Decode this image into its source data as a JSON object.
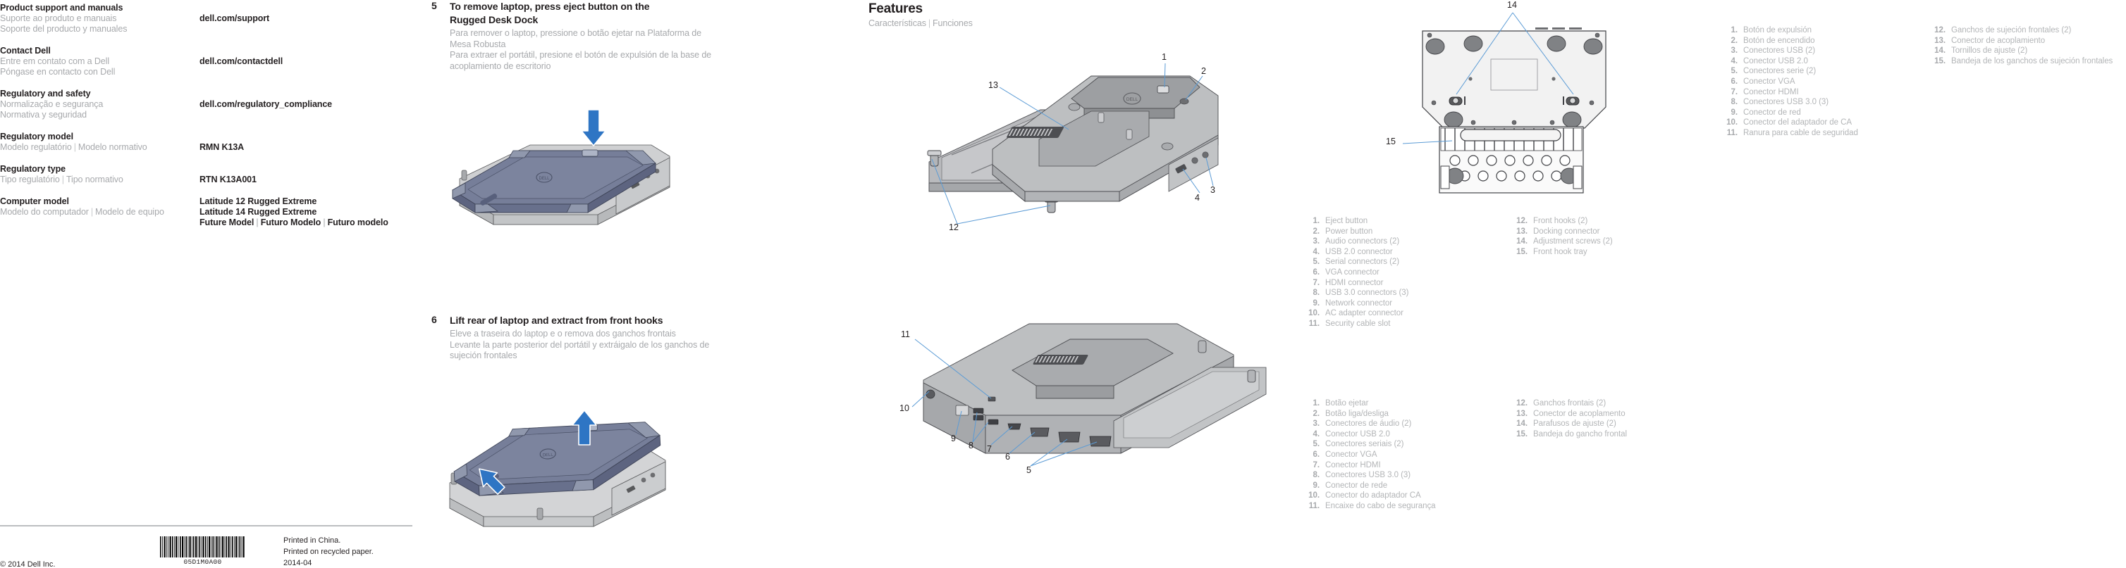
{
  "support": {
    "rows": [
      {
        "heading": "Product support and manuals",
        "pt": "Suporte ao produto e manuais",
        "es": "Soporte del producto y manuales",
        "value": "dell.com/support"
      },
      {
        "heading": "Contact Dell",
        "pt": "Entre em contato com a Dell",
        "es": "Póngase en contacto con Dell",
        "value": "dell.com/contactdell"
      },
      {
        "heading": "Regulatory and safety",
        "pt": "Normalização e segurança",
        "es": "Normativa y seguridad",
        "value": "dell.com/regulatory_compliance"
      },
      {
        "heading": "Regulatory model",
        "pt": "Modelo regulatório",
        "es": "Modelo normativo",
        "inline": true,
        "value": "RMN K13A"
      },
      {
        "heading": "Regulatory type",
        "pt": "Tipo regulatório",
        "es": "Tipo normativo",
        "inline": true,
        "value": "RTN K13A001"
      },
      {
        "heading": "Computer model",
        "pt": "Modelo do computador",
        "es": "Modelo de equipo",
        "inline": true,
        "value": "Latitude 12 Rugged Extreme",
        "value2": "Latitude 14 Rugged Extreme",
        "value3a": "Future Model",
        "value3b": "Futuro Modelo",
        "value3c": "Futuro modelo"
      }
    ]
  },
  "footer": {
    "copyright": "© 2014 Dell Inc.",
    "barcode_label": "05D1M0A00",
    "printed_in": "Printed in China.",
    "printed_on": "Printed on recycled paper.",
    "date": "2014-04"
  },
  "steps": [
    {
      "num": "5",
      "title_line1": "To remove laptop, press eject button on the",
      "title_line2": "Rugged Desk Dock",
      "pt_line1": "Para remover o laptop, pressione o botão ejetar na Plataforma de",
      "pt_line2": "Mesa Robusta",
      "es_line1": "Para extraer el portátil, presione el botón de expulsión de la base de",
      "es_line2": "acoplamiento de escritorio"
    },
    {
      "num": "6",
      "title_line1": "Lift rear of laptop and extract from front hooks",
      "title_line2": "",
      "pt_line1": "Eleve a traseira do laptop e o remova dos ganchos frontais",
      "pt_line2": "",
      "es_line1": "Levante la parte posterior del portátil y extráigalo de los ganchos de",
      "es_line2": "sujeción frontales"
    }
  ],
  "features": {
    "title": "Features",
    "sub_pt": "Características",
    "sub_es": "Funciones",
    "separator": "|",
    "callouts_fig1": [
      "1",
      "2",
      "3",
      "4",
      "12",
      "13"
    ],
    "callouts_fig2": [
      "5",
      "6",
      "7",
      "8",
      "9",
      "10",
      "11"
    ],
    "callouts_fig3": [
      "14",
      "15"
    ]
  },
  "feature_lists": {
    "en": {
      "left": [
        {
          "n": "1.",
          "t": "Eject button"
        },
        {
          "n": "2.",
          "t": "Power button"
        },
        {
          "n": "3.",
          "t": "Audio connectors (2)"
        },
        {
          "n": "4.",
          "t": "USB 2.0 connector"
        },
        {
          "n": "5.",
          "t": "Serial connectors (2)"
        },
        {
          "n": "6.",
          "t": "VGA connector"
        },
        {
          "n": "7.",
          "t": "HDMI connector"
        },
        {
          "n": "8.",
          "t": "USB 3.0 connectors (3)"
        },
        {
          "n": "9.",
          "t": "Network connector"
        },
        {
          "n": "10.",
          "t": "AC adapter connector"
        },
        {
          "n": "11.",
          "t": "Security cable slot"
        }
      ],
      "right": [
        {
          "n": "12.",
          "t": "Front hooks (2)"
        },
        {
          "n": "13.",
          "t": "Docking connector"
        },
        {
          "n": "14.",
          "t": "Adjustment screws (2)"
        },
        {
          "n": "15.",
          "t": "Front hook tray"
        }
      ]
    },
    "pt": {
      "left": [
        {
          "n": "1.",
          "t": "Botão ejetar"
        },
        {
          "n": "2.",
          "t": "Botão liga/desliga"
        },
        {
          "n": "3.",
          "t": "Conectores de áudio (2)"
        },
        {
          "n": "4.",
          "t": "Conector USB 2.0"
        },
        {
          "n": "5.",
          "t": "Conectores seriais (2)"
        },
        {
          "n": "6.",
          "t": "Conector VGA"
        },
        {
          "n": "7.",
          "t": "Conector HDMI"
        },
        {
          "n": "8.",
          "t": "Conectores USB 3.0 (3)"
        },
        {
          "n": "9.",
          "t": "Conector de rede"
        },
        {
          "n": "10.",
          "t": "Conector do adaptador CA"
        },
        {
          "n": "11.",
          "t": "Encaixe do cabo de segurança"
        }
      ],
      "right": [
        {
          "n": "12.",
          "t": "Ganchos frontais (2)"
        },
        {
          "n": "13.",
          "t": "Conector de acoplamento"
        },
        {
          "n": "14.",
          "t": "Parafusos de ajuste (2)"
        },
        {
          "n": "15.",
          "t": "Bandeja do gancho frontal"
        }
      ]
    },
    "es": {
      "left": [
        {
          "n": "1.",
          "t": "Botón de expulsión"
        },
        {
          "n": "2.",
          "t": "Botón de encendido"
        },
        {
          "n": "3.",
          "t": "Conectores USB (2)"
        },
        {
          "n": "4.",
          "t": "Conector USB 2.0"
        },
        {
          "n": "5.",
          "t": "Conectores serie (2)"
        },
        {
          "n": "6.",
          "t": "Conector VGA"
        },
        {
          "n": "7.",
          "t": "Conector HDMI"
        },
        {
          "n": "8.",
          "t": "Conectores USB 3.0 (3)"
        },
        {
          "n": "9.",
          "t": "Conector de red"
        },
        {
          "n": "10.",
          "t": "Conector del adaptador de CA"
        },
        {
          "n": "11.",
          "t": "Ranura para cable de seguridad"
        }
      ],
      "right": [
        {
          "n": "12.",
          "t": "Ganchos de sujeción frontales (2)"
        },
        {
          "n": "13.",
          "t": "Conector de acoplamiento"
        },
        {
          "n": "14.",
          "t": "Tornillos de ajuste (2)"
        },
        {
          "n": "15.",
          "t": "Bandeja de los ganchos de sujeción frontales"
        }
      ]
    }
  },
  "colors": {
    "arrow_blue": "#2e75c4",
    "leader_blue": "#5b9bd5",
    "laptop_body": "#6a7390",
    "dock_body": "#a6a8ab",
    "text_dark": "#231f20",
    "text_gray": "#a7a9ac"
  }
}
